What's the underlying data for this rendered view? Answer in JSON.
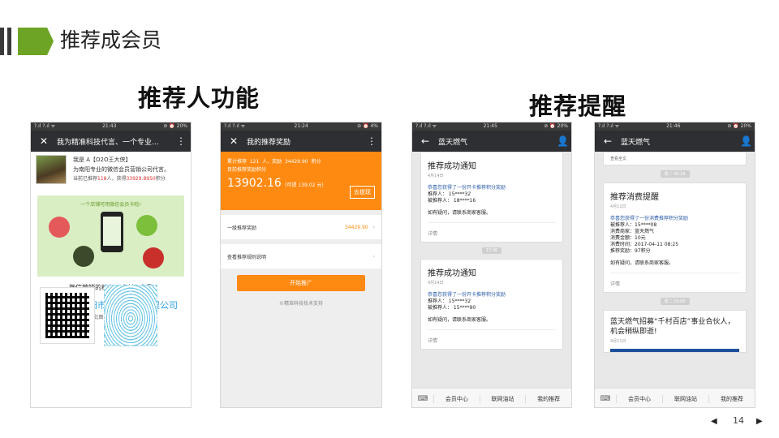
{
  "slide": {
    "title": "推荐成会员",
    "page_number": "14"
  },
  "sections": {
    "left": "推荐人功能",
    "right": "推荐提醒"
  },
  "phone1": {
    "status_left": "?.ıl ?.ıl ᯤ",
    "status_time": "21:43",
    "status_right": "⊘ ⏰ 20%",
    "nav_title": "我为精准科技代言、一个专业...",
    "line1": "我是 A【O2O王大侠】",
    "line2": "为南阳专业的微信会员营销公司代言。",
    "line3_prefix": "当前已推荐",
    "line3_count": "118",
    "line3_mid": "人，获得",
    "line3_points": "33929.8950",
    "line3_suffix": "积分",
    "banner_caption": "一个店铺可用微信会员卡啦!",
    "core_text": "微信营销的核心：支付+会员",
    "join_text": "立即加入南阳市精准科技有限公司",
    "hint_text": "长按此图识别图中二维码"
  },
  "phone2": {
    "status_left": "?.ıl ?.ıl ᯤ",
    "status_time": "21:24",
    "status_right": "⊘ ⏰ 4%",
    "nav_title": "我的推荐奖励",
    "total_line_prefix": "累计推荐",
    "total_count": "121",
    "total_mid": "人，奖励",
    "total_reward": "34429.90",
    "total_suffix": "积分",
    "current_label": "目前推荐奖励积分",
    "current_points": "13902.16",
    "current_withdrawable": "(可提 139.02 元)",
    "withdraw_button": "去提现",
    "row1_label": "一级推荐奖励",
    "row1_value": "34429.90",
    "row2_label": "查看推荐规则说明",
    "start_button": "开始推广",
    "footer": "©精准科技技术支持"
  },
  "phone3": {
    "status_left": "?.ıl ?.ıl ᯤ",
    "status_time": "21:45",
    "status_right": "⊘ ⏰ 20%",
    "nav_title": "蓝天燃气",
    "cards": [
      {
        "title": "推荐成功通知",
        "date": "4月14日",
        "headline": "恭喜您获得了一份开卡推荐积分奖励",
        "lines": [
          "推荐人：  15****32",
          "被推荐人：  18****16"
        ],
        "note": "如有疑问，请联系商家客服。",
        "detail": "详情"
      },
      {
        "title": "推荐成功通知",
        "date": "4月14日",
        "headline": "恭喜您获得了一份开卡推荐积分奖励",
        "lines": [
          "推荐人：  15****32",
          "被推荐人：  15****90"
        ],
        "note": "如有疑问，请联系商家客服。",
        "detail": "详情"
      }
    ],
    "time_badge": "17:06",
    "tabs": [
      "会员中心",
      "联网油站",
      "我的推荐"
    ]
  },
  "phone4": {
    "status_left": "?.ıl ?.ıl ᯤ",
    "status_time": "21:46",
    "status_right": "⊘ ⏰ 20%",
    "nav_title": "蓝天燃气",
    "top_fragment": "查看全文",
    "time_badge1": "周二 06:24",
    "card": {
      "title": "推荐消费提醒",
      "date": "4月11日",
      "headline": "恭喜您获得了一份消费推荐积分奖励",
      "lines": [
        "被推荐人：15****08",
        "消费商家：蓝天燃气",
        "消费金额：10元",
        "消费时间：2017-04-11 08:25",
        "推荐奖励：97积分"
      ],
      "note": "如有疑问，请联系商家客服。",
      "detail": "详情"
    },
    "time_badge2": "周二 23:00",
    "card2": {
      "title": "蓝天燃气招募“千村百店”事业合伙人，机会稍纵即逝!",
      "date": "4月11日"
    },
    "tabs": [
      "会员中心",
      "联网油站",
      "我的推荐"
    ]
  },
  "colors": {
    "accent_green": "#6ea425",
    "orange": "#ff8a12",
    "link_blue": "#2ca0e0"
  }
}
